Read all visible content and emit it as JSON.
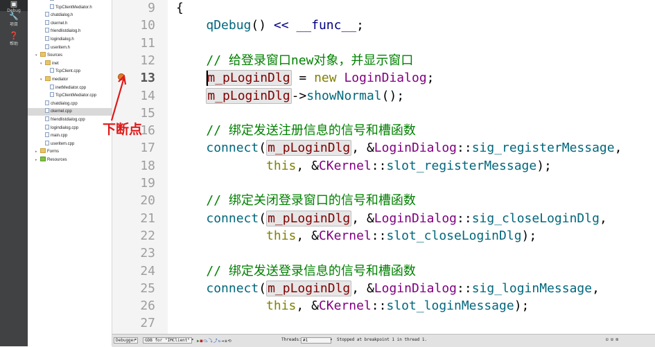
{
  "sidebar_rail": [
    {
      "label": "Debug",
      "icon": "debug-icon"
    },
    {
      "label": "项目",
      "icon": "wrench-icon"
    },
    {
      "label": "帮助",
      "icon": "help-icon"
    }
  ],
  "tree": [
    {
      "label": "inetMediator.h",
      "type": "file",
      "indent": 3,
      "arrow": ""
    },
    {
      "label": "TcpClientMediator.h",
      "type": "file",
      "indent": 3,
      "arrow": ""
    },
    {
      "label": "chatdialog.h",
      "type": "file",
      "indent": 2,
      "arrow": ""
    },
    {
      "label": "ckernel.h",
      "type": "file",
      "indent": 2,
      "arrow": ""
    },
    {
      "label": "friendlistdialog.h",
      "type": "file",
      "indent": 2,
      "arrow": ""
    },
    {
      "label": "logindialog.h",
      "type": "file",
      "indent": 2,
      "arrow": ""
    },
    {
      "label": "useritem.h",
      "type": "file",
      "indent": 2,
      "arrow": ""
    },
    {
      "label": "Sources",
      "type": "folder",
      "indent": 1,
      "arrow": "▾"
    },
    {
      "label": "inet",
      "type": "folder",
      "indent": 2,
      "arrow": "▾"
    },
    {
      "label": "TcpClient.cpp",
      "type": "file",
      "indent": 3,
      "arrow": ""
    },
    {
      "label": "mediator",
      "type": "folder",
      "indent": 2,
      "arrow": "▾"
    },
    {
      "label": "inetMediator.cpp",
      "type": "file",
      "indent": 3,
      "arrow": ""
    },
    {
      "label": "TcpClientMediator.cpp",
      "type": "file",
      "indent": 3,
      "arrow": ""
    },
    {
      "label": "chatdialog.cpp",
      "type": "file",
      "indent": 2,
      "arrow": ""
    },
    {
      "label": "ckernel.cpp",
      "type": "file",
      "indent": 2,
      "arrow": "",
      "selected": true
    },
    {
      "label": "friendlistdialog.cpp",
      "type": "file",
      "indent": 2,
      "arrow": ""
    },
    {
      "label": "logindialog.cpp",
      "type": "file",
      "indent": 2,
      "arrow": ""
    },
    {
      "label": "main.cpp",
      "type": "file",
      "indent": 2,
      "arrow": ""
    },
    {
      "label": "useritem.cpp",
      "type": "file",
      "indent": 2,
      "arrow": ""
    },
    {
      "label": "Forms",
      "type": "folder",
      "indent": 1,
      "arrow": "▸"
    },
    {
      "label": "Resources",
      "type": "qt",
      "indent": 1,
      "arrow": "▸"
    }
  ],
  "editor": {
    "line_numbers": [
      "9",
      "10",
      "11",
      "12",
      "13",
      "14",
      "15",
      "16",
      "17",
      "18",
      "19",
      "20",
      "21",
      "22",
      "23",
      "24",
      "25",
      "26",
      "27"
    ],
    "current_line": "13",
    "breakpoint_line": "13"
  },
  "annotation": "下断点",
  "status": {
    "debugger_label": "Debugger",
    "gdb_label": "GDB for \"IMClient\"",
    "threads_label": "Threads:",
    "thread_value": "#1",
    "message": "Stopped at breakpoint 1 in thread 1."
  },
  "colors": {
    "rail_bg": "#404244",
    "comment": "#008000",
    "keyword": "#808000",
    "member_var": "#800000",
    "class_name": "#800080",
    "function": "#00677c",
    "annotation": "#e01818",
    "breakpoint": "#e07a2e"
  }
}
